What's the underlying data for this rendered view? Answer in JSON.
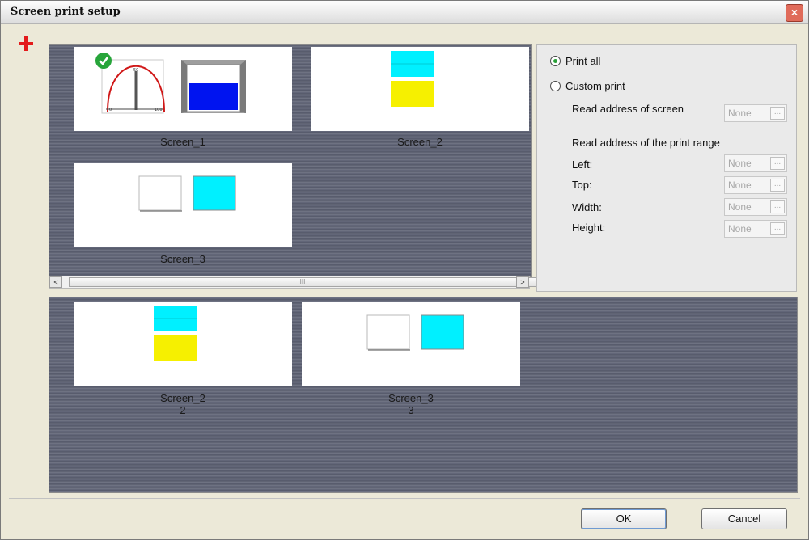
{
  "window": {
    "title": "Screen print setup",
    "close_glyph": "×"
  },
  "toolbar": {
    "add_icon": "plus-icon"
  },
  "screens_top": [
    {
      "label": "Screen_1",
      "selected_icon": "check-icon"
    },
    {
      "label": "Screen_2"
    },
    {
      "label": "Screen_3"
    }
  ],
  "screens_bottom": [
    {
      "label": "Screen_2",
      "number": "2"
    },
    {
      "label": "Screen_3",
      "number": "3"
    }
  ],
  "scrollbar": {
    "left": "<",
    "right": ">",
    "grip": "III"
  },
  "options": {
    "print_all": "Print all",
    "custom_print": "Custom print",
    "selected": "print_all",
    "read_address_screen": "Read address of screen",
    "read_address_range": "Read address of the print range",
    "left": "Left:",
    "top": "Top:",
    "width": "Width:",
    "height": "Height:",
    "none_value": "None",
    "browse": "..."
  },
  "footer": {
    "ok": "OK",
    "cancel": "Cancel"
  },
  "colors": {
    "cyan": "#00f0ff",
    "yellow": "#f6f000",
    "blue": "#0014f0",
    "gauge_red": "#d01818",
    "check_green": "#27a53a"
  }
}
